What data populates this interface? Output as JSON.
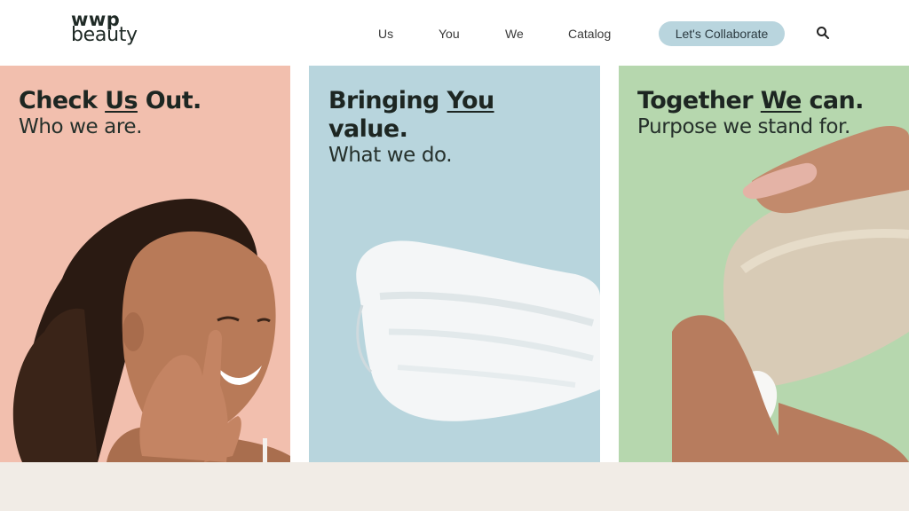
{
  "brand": {
    "line1": "wwp",
    "line2": "beauty"
  },
  "nav": {
    "links": [
      {
        "label": "Us"
      },
      {
        "label": "You"
      },
      {
        "label": "We"
      },
      {
        "label": "Catalog"
      }
    ],
    "cta_label": "Let's Collaborate",
    "search_icon": "search-icon"
  },
  "panels": [
    {
      "title_pre": "Check ",
      "title_em": "Us",
      "title_post": " Out.",
      "subtitle": "Who we are.",
      "color": "#f2bfae",
      "image": "smiling-woman-photo"
    },
    {
      "title_pre": "Bringing ",
      "title_em": "You",
      "title_line2": "value.",
      "subtitle": "What we do.",
      "color": "#b8d5dd",
      "image": "cream-swatch-photo"
    },
    {
      "title_pre": "Together ",
      "title_em": "We",
      "title_post": " can.",
      "subtitle": "Purpose we stand for.",
      "color": "#b6d7ae",
      "image": "hand-squeezing-tube-photo"
    }
  ]
}
